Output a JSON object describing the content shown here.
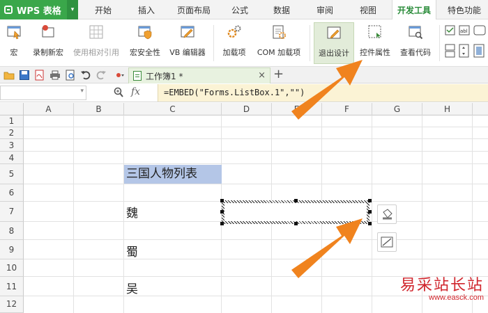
{
  "app": {
    "name": "WPS 表格"
  },
  "menu": {
    "tabs": [
      "开始",
      "插入",
      "页面布局",
      "公式",
      "数据",
      "审阅",
      "视图",
      "开发工具",
      "特色功能"
    ],
    "active": "开发工具"
  },
  "ribbon": {
    "macro": "宏",
    "record": "录制新宏",
    "relative_ref": "使用相对引用",
    "macro_security": "宏安全性",
    "vb_editor": "VB 编辑器",
    "addins": "加载项",
    "com_addins": "COM 加载项",
    "exit_design": "退出设计",
    "control_props": "控件属性",
    "view_code": "查看代码"
  },
  "document": {
    "tab_title": "工作簿1 *",
    "close": "×",
    "new": "+"
  },
  "formula_bar": {
    "fx": "fx",
    "formula": "=EMBED(\"Forms.ListBox.1\",\"\")"
  },
  "grid": {
    "columns": [
      "A",
      "B",
      "C",
      "D",
      "E",
      "F",
      "G",
      "H"
    ],
    "rows": [
      "1",
      "2",
      "3",
      "4",
      "5",
      "6",
      "7",
      "8",
      "9",
      "10",
      "11",
      "12"
    ],
    "cells": {
      "C5": "三国人物列表",
      "C7": "魏",
      "C9": "蜀",
      "C11": "吴"
    }
  },
  "watermark": {
    "text": "易采站长站",
    "url": "www.easck.com"
  },
  "colors": {
    "accent": "#3aa74a",
    "highlight": "#b4c6e7",
    "arrow": "#f0831e",
    "watermark": "#d0252c"
  }
}
